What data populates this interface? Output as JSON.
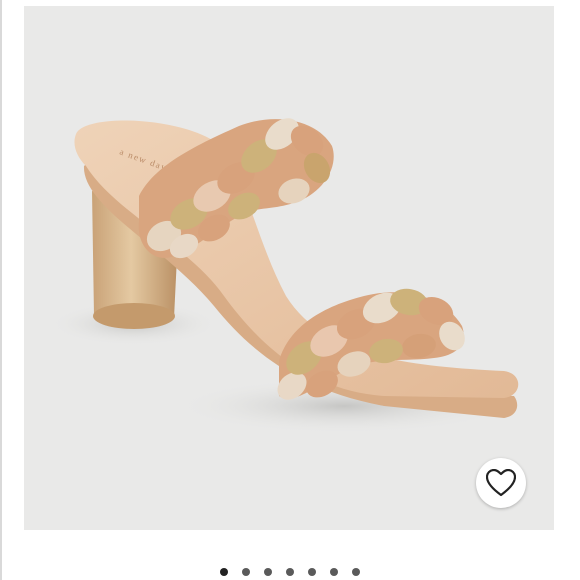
{
  "product_image": {
    "brand_imprint": "a new day",
    "background_color": "#e9e9e8",
    "subject": "braided-double-strap-block-heel-sandal",
    "colors": {
      "footbed": "#e8c6a6",
      "heel": "#d9b78c",
      "strap_tan": "#d8a27c",
      "strap_gold": "#cdb27a",
      "strap_cream": "#e9dccb"
    }
  },
  "favorite": {
    "icon": "heart-icon",
    "label": ""
  },
  "carousel": {
    "total": 7,
    "active_index": 0
  }
}
